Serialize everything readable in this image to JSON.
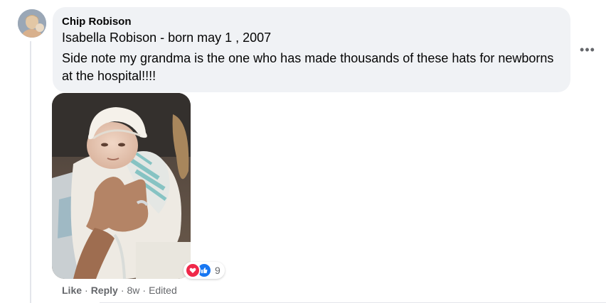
{
  "comment": {
    "author": "Chip Robison",
    "lines": [
      "Isabella Robison - born may 1 , 2007",
      "Side note my grandma is the one who has made thousands of these hats for newborns at the hospital!!!!"
    ]
  },
  "menu": {
    "more_icon": "more-horizontal-icon",
    "more_glyph": "•••"
  },
  "photo": {
    "alt": "newborn-baby-photo"
  },
  "reactions": {
    "icons": [
      "love-reaction-icon",
      "like-reaction-icon"
    ],
    "count": "9",
    "colors": {
      "love": "#f02849",
      "like": "#1877f2"
    }
  },
  "actions": {
    "like": "Like",
    "separator": "·",
    "reply": "Reply",
    "time": "8w",
    "edited": "Edited"
  },
  "colors": {
    "bubble": "#f0f2f5",
    "text": "#050505",
    "secondary": "#65676b"
  }
}
